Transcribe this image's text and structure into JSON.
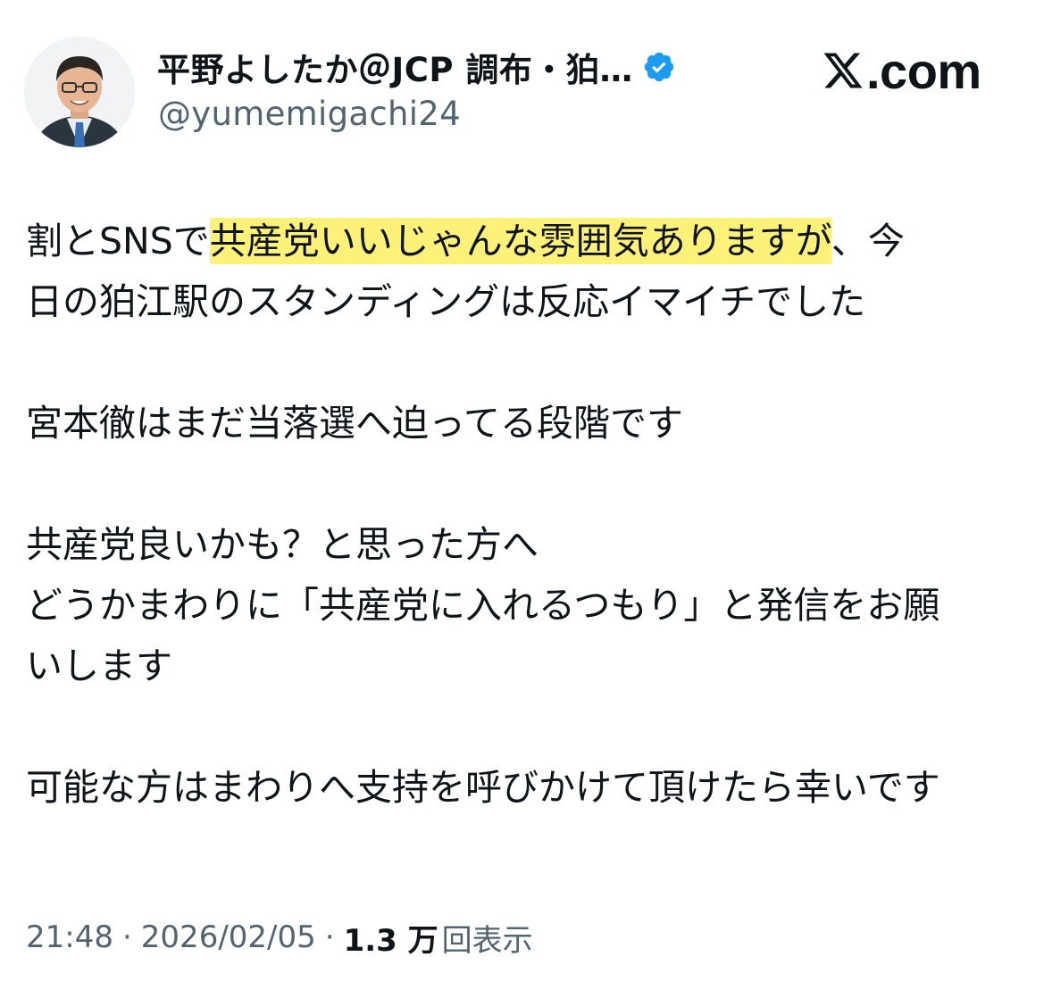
{
  "author": {
    "display_name": "平野よしたか＠JCP 調布・狛…",
    "handle": "@yumemigachi24",
    "verified_icon": "verified-badge-icon",
    "avatar": "avatar-photo"
  },
  "brand": {
    "logo_icon": "x-logo-icon",
    "text": ".com"
  },
  "tweet": {
    "line1_pre": "割とSNSで",
    "line1_highlight": "共産党いいじゃんな雰囲気ありますが",
    "line1_post": "、今",
    "line2": "日の狛江駅のスタンディングは反応イマイチでした",
    "line3": "宮本徹はまだ当落選へ迫ってる段階です",
    "line4": "共産党良いかも？と思った方へ",
    "line5": "どうかまわりに「共産党に入れるつもり」と発信をお願",
    "line6": "いします",
    "line7": "可能な方はまわりへ支持を呼びかけて頂けたら幸いです"
  },
  "meta": {
    "time": "21:48",
    "separator": "·",
    "date": "2026/02/05",
    "views_count": "1.3 万",
    "views_label": "回表示"
  },
  "colors": {
    "text": "#0f1419",
    "secondary": "#536471",
    "highlight": "#fdf17a",
    "verified": "#1d9bf0"
  }
}
